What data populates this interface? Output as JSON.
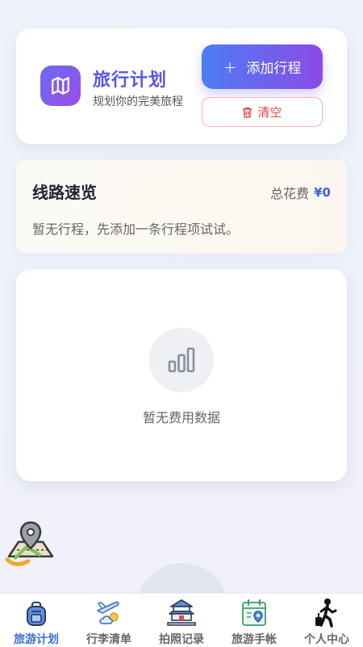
{
  "header": {
    "title": "旅行计划",
    "subtitle": "规划你的完美旅程",
    "add_label": "添加行程",
    "clear_label": "清空"
  },
  "route": {
    "title": "线路速览",
    "total_label": "总花费",
    "total_amount": "¥0",
    "empty_text": "暂无行程，先添加一条行程项试试。"
  },
  "cost": {
    "empty_text": "暂无费用数据"
  },
  "nav": {
    "items": [
      {
        "label": "旅游计划",
        "icon": "backpack-icon",
        "active": true
      },
      {
        "label": "行李清单",
        "icon": "plane-weather-icon",
        "active": false
      },
      {
        "label": "拍照记录",
        "icon": "pagoda-icon",
        "active": false
      },
      {
        "label": "旅游手帐",
        "icon": "calendar-map-icon",
        "active": false
      },
      {
        "label": "个人中心",
        "icon": "traveler-icon",
        "active": false
      }
    ]
  },
  "colors": {
    "accent": "#5a55e6",
    "active_nav": "#3c6fd8",
    "danger": "#e0474c",
    "price": "#3c64d8"
  }
}
